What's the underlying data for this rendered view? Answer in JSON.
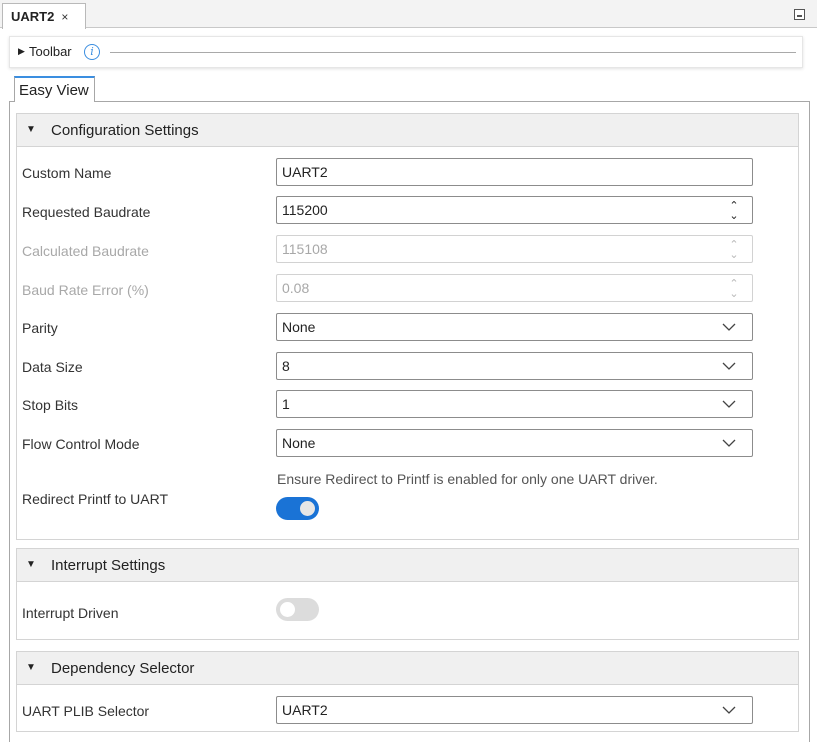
{
  "tab": {
    "title": "UART2",
    "close": "×"
  },
  "toolbar": {
    "label": "Toolbar",
    "info_icon": "i"
  },
  "view_tab": "Easy View",
  "sections": {
    "config": {
      "title": "Configuration Settings",
      "custom_name": {
        "label": "Custom Name",
        "value": "UART2"
      },
      "requested_baudrate": {
        "label": "Requested Baudrate",
        "value": "115200"
      },
      "calculated_baudrate": {
        "label": "Calculated Baudrate",
        "value": "115108"
      },
      "baud_rate_error": {
        "label": "Baud Rate Error (%)",
        "value": "0.08"
      },
      "parity": {
        "label": "Parity",
        "value": "None"
      },
      "data_size": {
        "label": "Data Size",
        "value": "8"
      },
      "stop_bits": {
        "label": "Stop Bits",
        "value": "1"
      },
      "flow_control": {
        "label": "Flow Control Mode",
        "value": "None"
      },
      "redirect_printf": {
        "label": "Redirect Printf to UART",
        "note": "Ensure Redirect to Printf is enabled for only one UART driver.",
        "enabled": true
      }
    },
    "interrupt": {
      "title": "Interrupt Settings",
      "interrupt_driven": {
        "label": "Interrupt Driven",
        "enabled": false
      }
    },
    "dependency": {
      "title": "Dependency Selector",
      "plib_selector": {
        "label": "UART PLIB Selector",
        "value": "UART2"
      }
    }
  },
  "colors": {
    "accent": "#1a73d6",
    "info": "#3b8ee0",
    "header_bg": "#f0f0f0"
  }
}
